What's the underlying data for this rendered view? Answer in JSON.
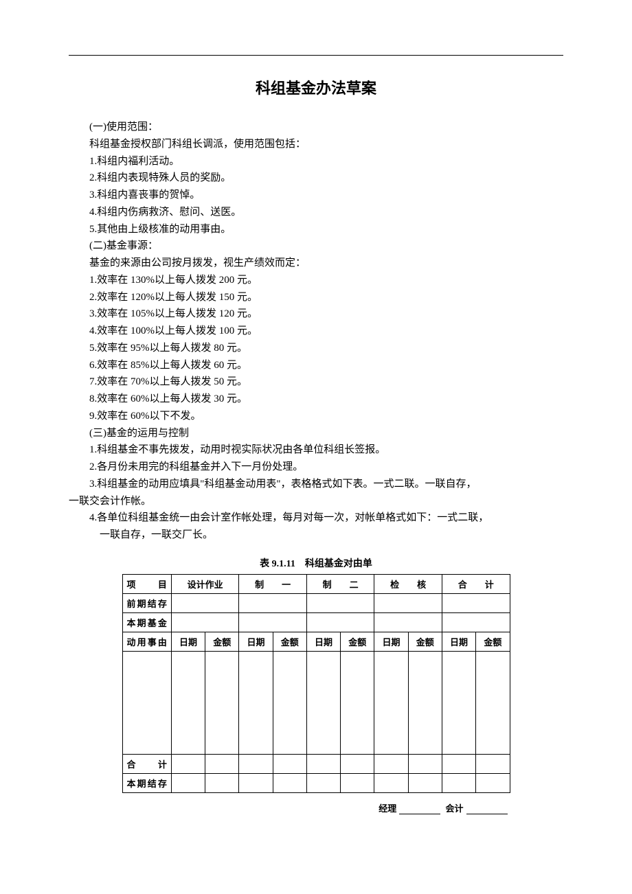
{
  "title": "科组基金办法草案",
  "sections": {
    "s1_header": "(一)使用范围：",
    "s1_intro": "科组基金授权部门科组长调派，使用范围包括：",
    "s1_items": [
      "1.科组内福利活动。",
      "2.科组内表现特殊人员的奖励。",
      "3.科组内喜丧事的贺悼。",
      "4.科组内伤病救济、慰问、送医。",
      "5.其他由上级核准的动用事由。"
    ],
    "s2_header": "(二)基金事源：",
    "s2_intro": "基金的来源由公司按月拨发，视生产绩效而定：",
    "s2_items": [
      "1.效率在 130%以上每人拨发 200 元。",
      "2.效率在 120%以上每人拨发 150 元。",
      "3.效率在 105%以上每人拨发 120 元。",
      "4.效率在 100%以上每人拨发 100 元。",
      "5.效率在 95%以上每人拨发 80 元。",
      "6.效率在 85%以上每人拨发 60 元。",
      "7.效率在 70%以上每人拨发 50 元。",
      "8.效率在 60%以上每人拨发 30 元。",
      "9.效率在 60%以下不发。"
    ],
    "s3_header": "(三)基金的运用与控制",
    "s3_items": [
      "1.科组基金不事先拨发，动用时视实际状况由各单位科组长签报。",
      "2.各月份未用完的科组基金并入下一月份处理。"
    ],
    "s3_item3a": "3.科组基金的动用应填具\"科组基金动用表\"，表格格式如下表。一式二联。一联自存，",
    "s3_item3b": "一联交会计作帐。",
    "s3_item4a": "4.各单位科组基金统一由会计室作帐处理，每月对每一次，对帐单格式如下：一式二联，",
    "s3_item4b": "一联自存，一联交厂长。"
  },
  "table": {
    "caption": "表 9.1.11　科组基金对由单",
    "headers": {
      "c1": "项　　目",
      "c2": "设计作业",
      "c3": "制　　一",
      "c4": "制　　二",
      "c5": "检　　核",
      "c6": "合　　计"
    },
    "sub": {
      "date": "日期",
      "amount": "金额"
    },
    "rows": {
      "r1": "前期结存",
      "r2": "本期基金",
      "r3": "动用事由",
      "r4": "合　　计",
      "r5": "本期结存"
    }
  },
  "signature": {
    "s1": "经理",
    "s2": "会计"
  }
}
